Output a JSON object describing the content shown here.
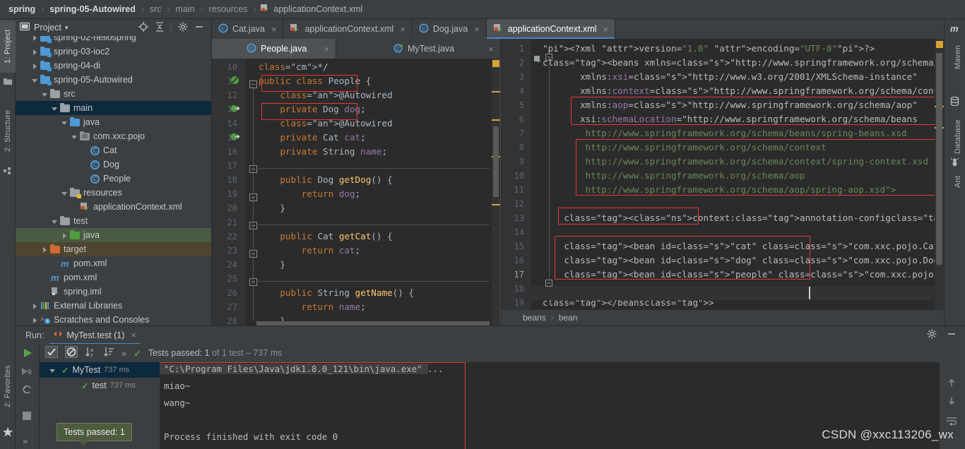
{
  "breadcrumb": {
    "items": [
      "spring",
      "spring-05-Autowired",
      "src",
      "main",
      "resources",
      "applicationContext.xml"
    ],
    "separator": "›"
  },
  "left_strip": {
    "project_label": "1: Project",
    "structure_label": "2: Structure",
    "favorites_label": "2: Favorites"
  },
  "right_strip": {
    "maven_label": "Maven",
    "database_label": "Database",
    "ant_label": "Ant"
  },
  "project_panel": {
    "title": "Project",
    "dropdown_caret": "▾",
    "tree": [
      {
        "label": "spring-02-hellospring",
        "indent": 1,
        "arrow": "right",
        "icon": "folder-module",
        "clipped": true
      },
      {
        "label": "spring-03-ioc2",
        "indent": 1,
        "arrow": "right",
        "icon": "folder-module"
      },
      {
        "label": "spring-04-di",
        "indent": 1,
        "arrow": "right",
        "icon": "folder-module"
      },
      {
        "label": "spring-05-Autowired",
        "indent": 1,
        "arrow": "down",
        "icon": "folder-module"
      },
      {
        "label": "src",
        "indent": 2,
        "arrow": "down",
        "icon": "folder-gray"
      },
      {
        "label": "main",
        "indent": 3,
        "arrow": "down",
        "icon": "folder-gray",
        "state": "selected"
      },
      {
        "label": "java",
        "indent": 4,
        "arrow": "down",
        "icon": "folder-blue"
      },
      {
        "label": "com.xxc.pojo",
        "indent": 5,
        "arrow": "down",
        "icon": "folder-package"
      },
      {
        "label": "Cat",
        "indent": 6,
        "arrow": "none",
        "icon": "class"
      },
      {
        "label": "Dog",
        "indent": 6,
        "arrow": "none",
        "icon": "class"
      },
      {
        "label": "People",
        "indent": 6,
        "arrow": "none",
        "icon": "class"
      },
      {
        "label": "resources",
        "indent": 4,
        "arrow": "down",
        "icon": "folder-resources"
      },
      {
        "label": "applicationContext.xml",
        "indent": 5,
        "arrow": "none",
        "icon": "spring-xml"
      },
      {
        "label": "test",
        "indent": 3,
        "arrow": "down",
        "icon": "folder-gray"
      },
      {
        "label": "java",
        "indent": 4,
        "arrow": "right",
        "icon": "folder-green",
        "state": "test-highlight"
      },
      {
        "label": "target",
        "indent": 2,
        "arrow": "right",
        "icon": "folder-orange",
        "state": "excluded-highlight"
      },
      {
        "label": "pom.xml",
        "indent": 3,
        "arrow": "none",
        "icon": "maven"
      },
      {
        "label": "pom.xml",
        "indent": 2,
        "arrow": "none",
        "icon": "maven"
      },
      {
        "label": "spring.iml",
        "indent": 2,
        "arrow": "none",
        "icon": "iml"
      },
      {
        "label": "External Libraries",
        "indent": 1,
        "arrow": "right",
        "icon": "libraries"
      },
      {
        "label": "Scratches and Consoles",
        "indent": 1,
        "arrow": "right",
        "icon": "scratches"
      }
    ]
  },
  "editor": {
    "tabs": [
      {
        "label": "Cat.java",
        "icon": "java-class-icon",
        "active": false
      },
      {
        "label": "applicationContext.xml",
        "icon": "spring-xml-icon",
        "active": false
      },
      {
        "label": "Dog.java",
        "icon": "java-class-icon",
        "active": false
      },
      {
        "label": "applicationContext.xml",
        "icon": "spring-xml-icon",
        "active": true
      }
    ],
    "split_tabs": [
      {
        "label": "People.java",
        "icon": "java-class-icon",
        "active": true
      },
      {
        "label": "MyTest.java",
        "icon": "java-test-icon",
        "active": false
      }
    ],
    "close_glyph": "×"
  },
  "java_code": {
    "first_line_number": 10,
    "lines": [
      "*/",
      "public class People {",
      "    @Autowired",
      "    private Dog dog;",
      "    @Autowired",
      "    private Cat cat;",
      "    private String name;",
      "",
      "    public Dog getDog() {",
      "        return dog;",
      "    }",
      "",
      "    public Cat getCat() {",
      "        return cat;",
      "    }",
      "",
      "    public String getName() {",
      "        return name;",
      "    }"
    ]
  },
  "xml_code": {
    "first_line_number": 1,
    "lines": [
      "<?xml version=\"1.0\" encoding=\"UTF-8\"?>",
      "<beans xmlns=\"http://www.springframework.org/schema/beans\"",
      "       xmlns:xsi=\"http://www.w3.org/2001/XMLSchema-instance\"",
      "       xmlns:context=\"http://www.springframework.org/schema/context\"",
      "       xmlns:aop=\"http://www.springframework.org/schema/aop\"",
      "       xsi:schemaLocation=\"http://www.springframework.org/schema/beans",
      "        http://www.springframework.org/schema/beans/spring-beans.xsd",
      "        http://www.springframework.org/schema/context",
      "        http://www.springframework.org/schema/context/spring-context.xsd",
      "        http://www.springframework.org/schema/aop",
      "        http://www.springframework.org/schema/aop/spring-aop.xsd\">",
      "",
      "    <context:annotation-config/>",
      "",
      "    <bean id=\"cat\" class=\"com.xxc.pojo.Cat\"/>",
      "    <bean id=\"dog\" class=\"com.xxc.pojo.Dog\"/>",
      "    <bean id=\"people\" class=\"com.xxc.pojo.People\"/>",
      "",
      "</beans>"
    ],
    "caret_line": 17,
    "breadcrumb": [
      "beans",
      "bean"
    ],
    "breadcrumb_separator": "›"
  },
  "run_panel": {
    "run_label": "Run:",
    "tab_label": "MyTest.test (1)",
    "tab_close": "×",
    "status_text": "Tests passed: 1 of 1 test – 737 ms",
    "status_passed": "Tests passed: 1",
    "status_rest": " of 1 test – 737 ms",
    "tree": [
      {
        "label": "MyTest",
        "time": "737 ms",
        "selected": true,
        "arrow": "down"
      },
      {
        "label": "test",
        "time": "737 ms",
        "selected": false,
        "arrow": "none"
      }
    ],
    "console": [
      "\"C:\\Program Files\\Java\\jdk1.8.0_121\\bin\\java.exe\" ...",
      "miao~",
      "wang~",
      "",
      "Process finished with exit code 0"
    ],
    "tooltip": "Tests passed: 1"
  },
  "watermark": "CSDN @xxc113206_wx",
  "colors": {
    "accent_blue": "#4a88c7",
    "annotation_box": "#e53935",
    "selection": "#0d293e",
    "editor_bg": "#2b2b2b",
    "panel_bg": "#3c3f41"
  }
}
